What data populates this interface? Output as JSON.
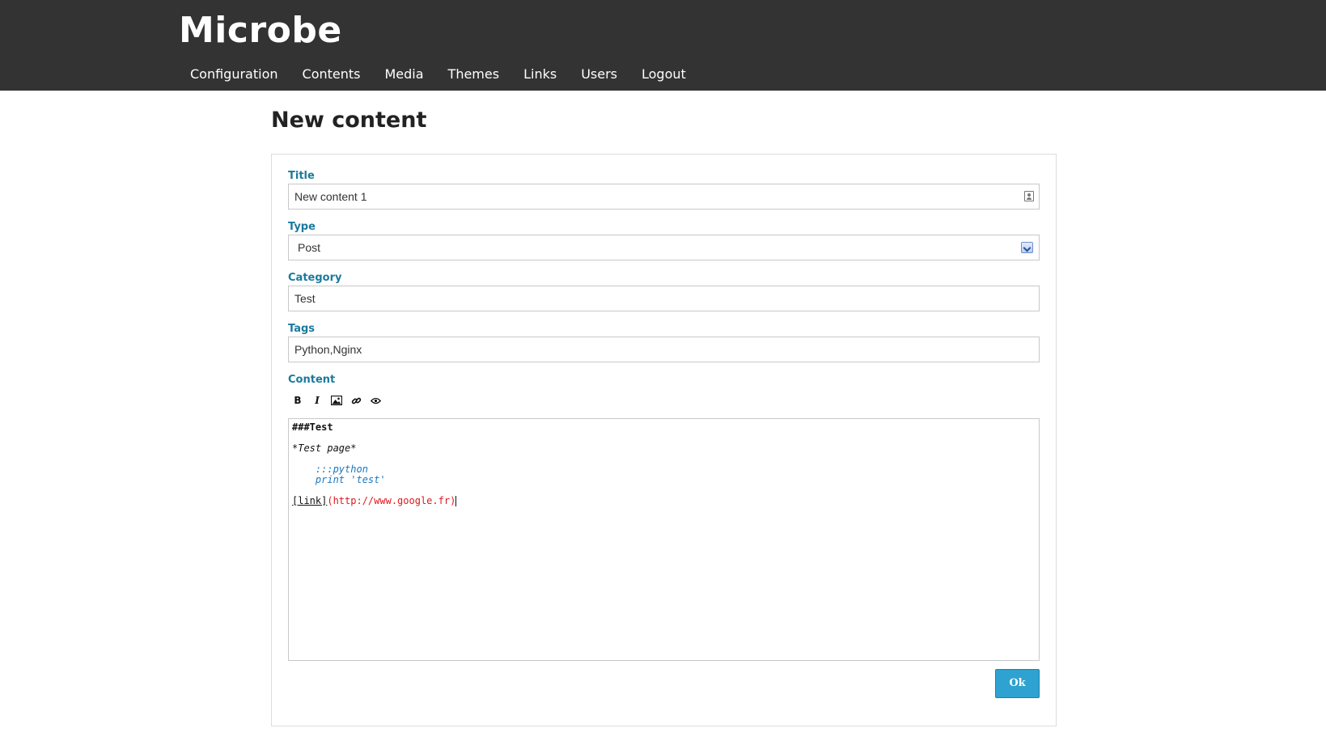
{
  "app": {
    "brand": "Microbe"
  },
  "nav": {
    "items": [
      {
        "label": "Configuration"
      },
      {
        "label": "Contents"
      },
      {
        "label": "Media"
      },
      {
        "label": "Themes"
      },
      {
        "label": "Links"
      },
      {
        "label": "Users"
      },
      {
        "label": "Logout"
      }
    ]
  },
  "page": {
    "title": "New content"
  },
  "form": {
    "title": {
      "label": "Title",
      "value": "New content 1",
      "icon": "contact-card-icon"
    },
    "type": {
      "label": "Type",
      "value": "Post",
      "icon": "chevron-down-icon"
    },
    "category": {
      "label": "Category",
      "value": "Test"
    },
    "tags": {
      "label": "Tags",
      "value": "Python,Nginx"
    },
    "content": {
      "label": "Content",
      "toolbar": {
        "bold": {
          "label": "B",
          "icon": "bold-icon"
        },
        "italic": {
          "label": "I",
          "icon": "italic-icon"
        },
        "image": {
          "icon": "image-icon"
        },
        "link": {
          "icon": "link-icon"
        },
        "preview": {
          "icon": "eye-icon"
        }
      },
      "lines": {
        "heading": "###Test",
        "emphasis": "*Test page*",
        "code1": "    :::python",
        "code2": "    print 'test'",
        "link_text": "[link]",
        "link_url": "(http://www.google.fr)"
      }
    },
    "submit_label": "Ok"
  },
  "colors": {
    "topbar": "#333333",
    "label": "#1b7a9e",
    "button": "#2ea2d0",
    "code": "#1a78c2",
    "url": "#e0161c"
  }
}
